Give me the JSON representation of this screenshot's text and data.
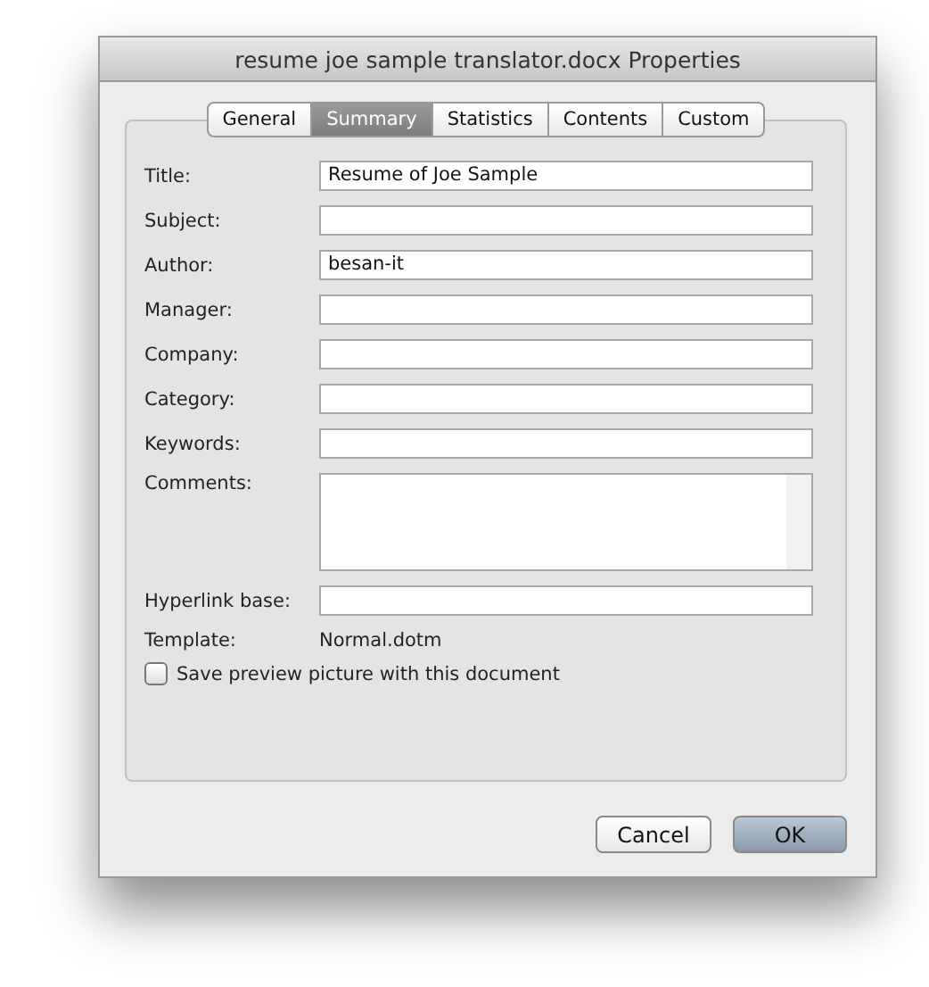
{
  "window": {
    "title": "resume joe sample translator.docx Properties"
  },
  "tabs": [
    {
      "label": "General",
      "selected": false
    },
    {
      "label": "Summary",
      "selected": true
    },
    {
      "label": "Statistics",
      "selected": false
    },
    {
      "label": "Contents",
      "selected": false
    },
    {
      "label": "Custom",
      "selected": false
    }
  ],
  "fields": [
    {
      "kind": "text",
      "label": "Title:",
      "value": "Resume of Joe Sample"
    },
    {
      "kind": "text",
      "label": "Subject:"
    },
    {
      "kind": "text",
      "label": "Author:",
      "value": "besan-it"
    },
    {
      "kind": "text",
      "label": "Manager:"
    },
    {
      "kind": "text",
      "label": "Company:"
    },
    {
      "kind": "text",
      "label": "Category:"
    },
    {
      "kind": "text",
      "label": "Keywords:"
    },
    {
      "kind": "multiline",
      "label": "Comments:"
    },
    {
      "kind": "text",
      "label": "Hyperlink base:"
    },
    {
      "kind": "static",
      "label": "Template:",
      "value": "Normal.dotm"
    }
  ],
  "checkbox": {
    "label": "Save preview picture with this document",
    "checked": false
  },
  "buttons": [
    {
      "label": "Cancel",
      "default": false
    },
    {
      "label": "OK",
      "default": true
    }
  ]
}
